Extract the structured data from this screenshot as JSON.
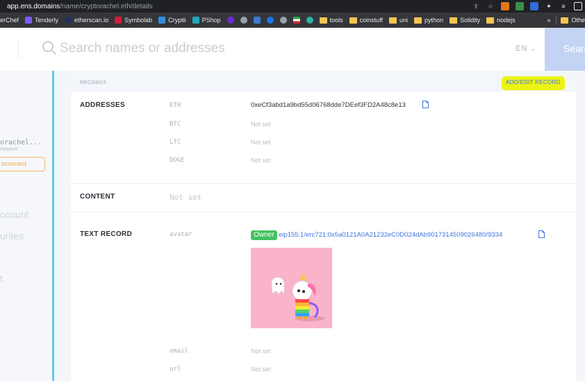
{
  "browser": {
    "url_host": "app.ens.domains",
    "url_path": "/name/cryptorachel.eth/details",
    "bookmarks": [
      {
        "label": "erChef",
        "color": "#e9732b"
      },
      {
        "label": "Tenderly",
        "color": "#7a5cf0"
      },
      {
        "label": "etherscan.io",
        "color": "#21325b"
      },
      {
        "label": "Symbolab",
        "color": "#d1203c"
      },
      {
        "label": "Cryptii",
        "color": "#2f8fe0"
      },
      {
        "label": "PShop",
        "color": "#1ea8b8"
      }
    ],
    "folders": [
      "tools",
      "coinstuff",
      "uni",
      "python",
      "Solidity",
      "nodejs"
    ],
    "overflow_label": "»",
    "other_label": "Othe"
  },
  "header": {
    "search_placeholder": "Search names or addresses",
    "language": "EN",
    "search_button": "Search"
  },
  "sidebar": {
    "account_name": "orachel...",
    "network_label": "Network",
    "disconnect_label": "sconnect",
    "nav_account": "ccount",
    "nav_favourites": "urites",
    "nav_about": "t"
  },
  "records": {
    "header_label": "RECORDS",
    "add_edit_label": "ADD/EDIT RECORD",
    "addresses": {
      "title": "ADDRESSES",
      "items": [
        {
          "key": "ETH",
          "value": "0xeCf3abd1a9bd55d06768dde7DEef3FD2A48c8e13"
        },
        {
          "key": "BTC",
          "value": "Not set"
        },
        {
          "key": "LTC",
          "value": "Not set"
        },
        {
          "key": "DOGE",
          "value": "Not set"
        }
      ]
    },
    "content": {
      "title": "CONTENT",
      "value": "Not set"
    },
    "text_record": {
      "title": "TEXT RECORD",
      "avatar_key": "avatar",
      "owner_badge": "Owner",
      "avatar_value": "eip155:1/erc721:0x5a0121A0A21232eC0D024dAb9017314509026480/9334",
      "email_key": "email",
      "email_value": "Not set",
      "url_key": "url",
      "url_value": "Not set"
    }
  },
  "colors": {
    "accent": "#5ec6ee",
    "highlight": "#ecf414",
    "link": "#3f74de",
    "owner": "#45c15f",
    "disconnect": "#f3a546"
  }
}
